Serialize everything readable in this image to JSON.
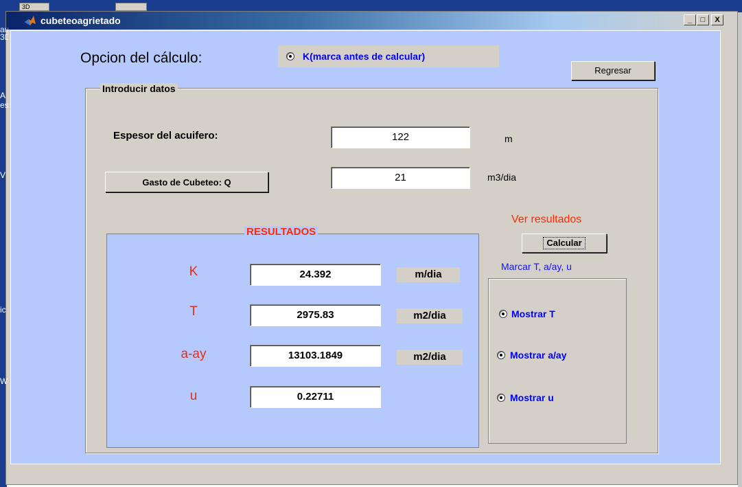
{
  "window": {
    "title": "cubeteoagrietado",
    "minimize": "_",
    "maximize": "□",
    "close": "X"
  },
  "background": {
    "tab_1": "3D",
    "tab_2": "",
    "left_edge_text": [
      "au",
      "3D",
      "A",
      "es",
      "V",
      "ic",
      "W"
    ]
  },
  "option": {
    "label": "Opcion del cálculo:",
    "radio_label": "K(marca antes de calcular)",
    "radio_selected": true
  },
  "regresar_label": "Regresar",
  "input_group": {
    "title": "Introducir datos",
    "espesor_label": "Espesor del acuifero:",
    "espesor_value": "122",
    "espesor_unit": "m",
    "gasto_button": "Gasto de Cubeteo: Q",
    "gasto_value": "21",
    "gasto_unit": "m3/dia"
  },
  "results": {
    "title": "RESULTADOS",
    "rows": [
      {
        "label": "K",
        "value": "24.392",
        "unit": "m/dia"
      },
      {
        "label": "T",
        "value": "2975.83",
        "unit": "m2/dia"
      },
      {
        "label": "a-ay",
        "value": "13103.1849",
        "unit": "m2/dia"
      },
      {
        "label": "u",
        "value": "0.22711",
        "unit": ""
      }
    ]
  },
  "side": {
    "ver_resultados": "Ver resultados",
    "calcular": "Calcular",
    "marcar": "Marcar T, a/ay, u",
    "options": [
      {
        "label": "Mostrar T",
        "selected": true
      },
      {
        "label": "Mostrar a/ay",
        "selected": true
      },
      {
        "label": "Mostrar u",
        "selected": true
      }
    ]
  },
  "colors": {
    "panel_blue": "#b6c9fc",
    "result_red": "#ff2a00",
    "radio_blue": "#0000ff"
  }
}
